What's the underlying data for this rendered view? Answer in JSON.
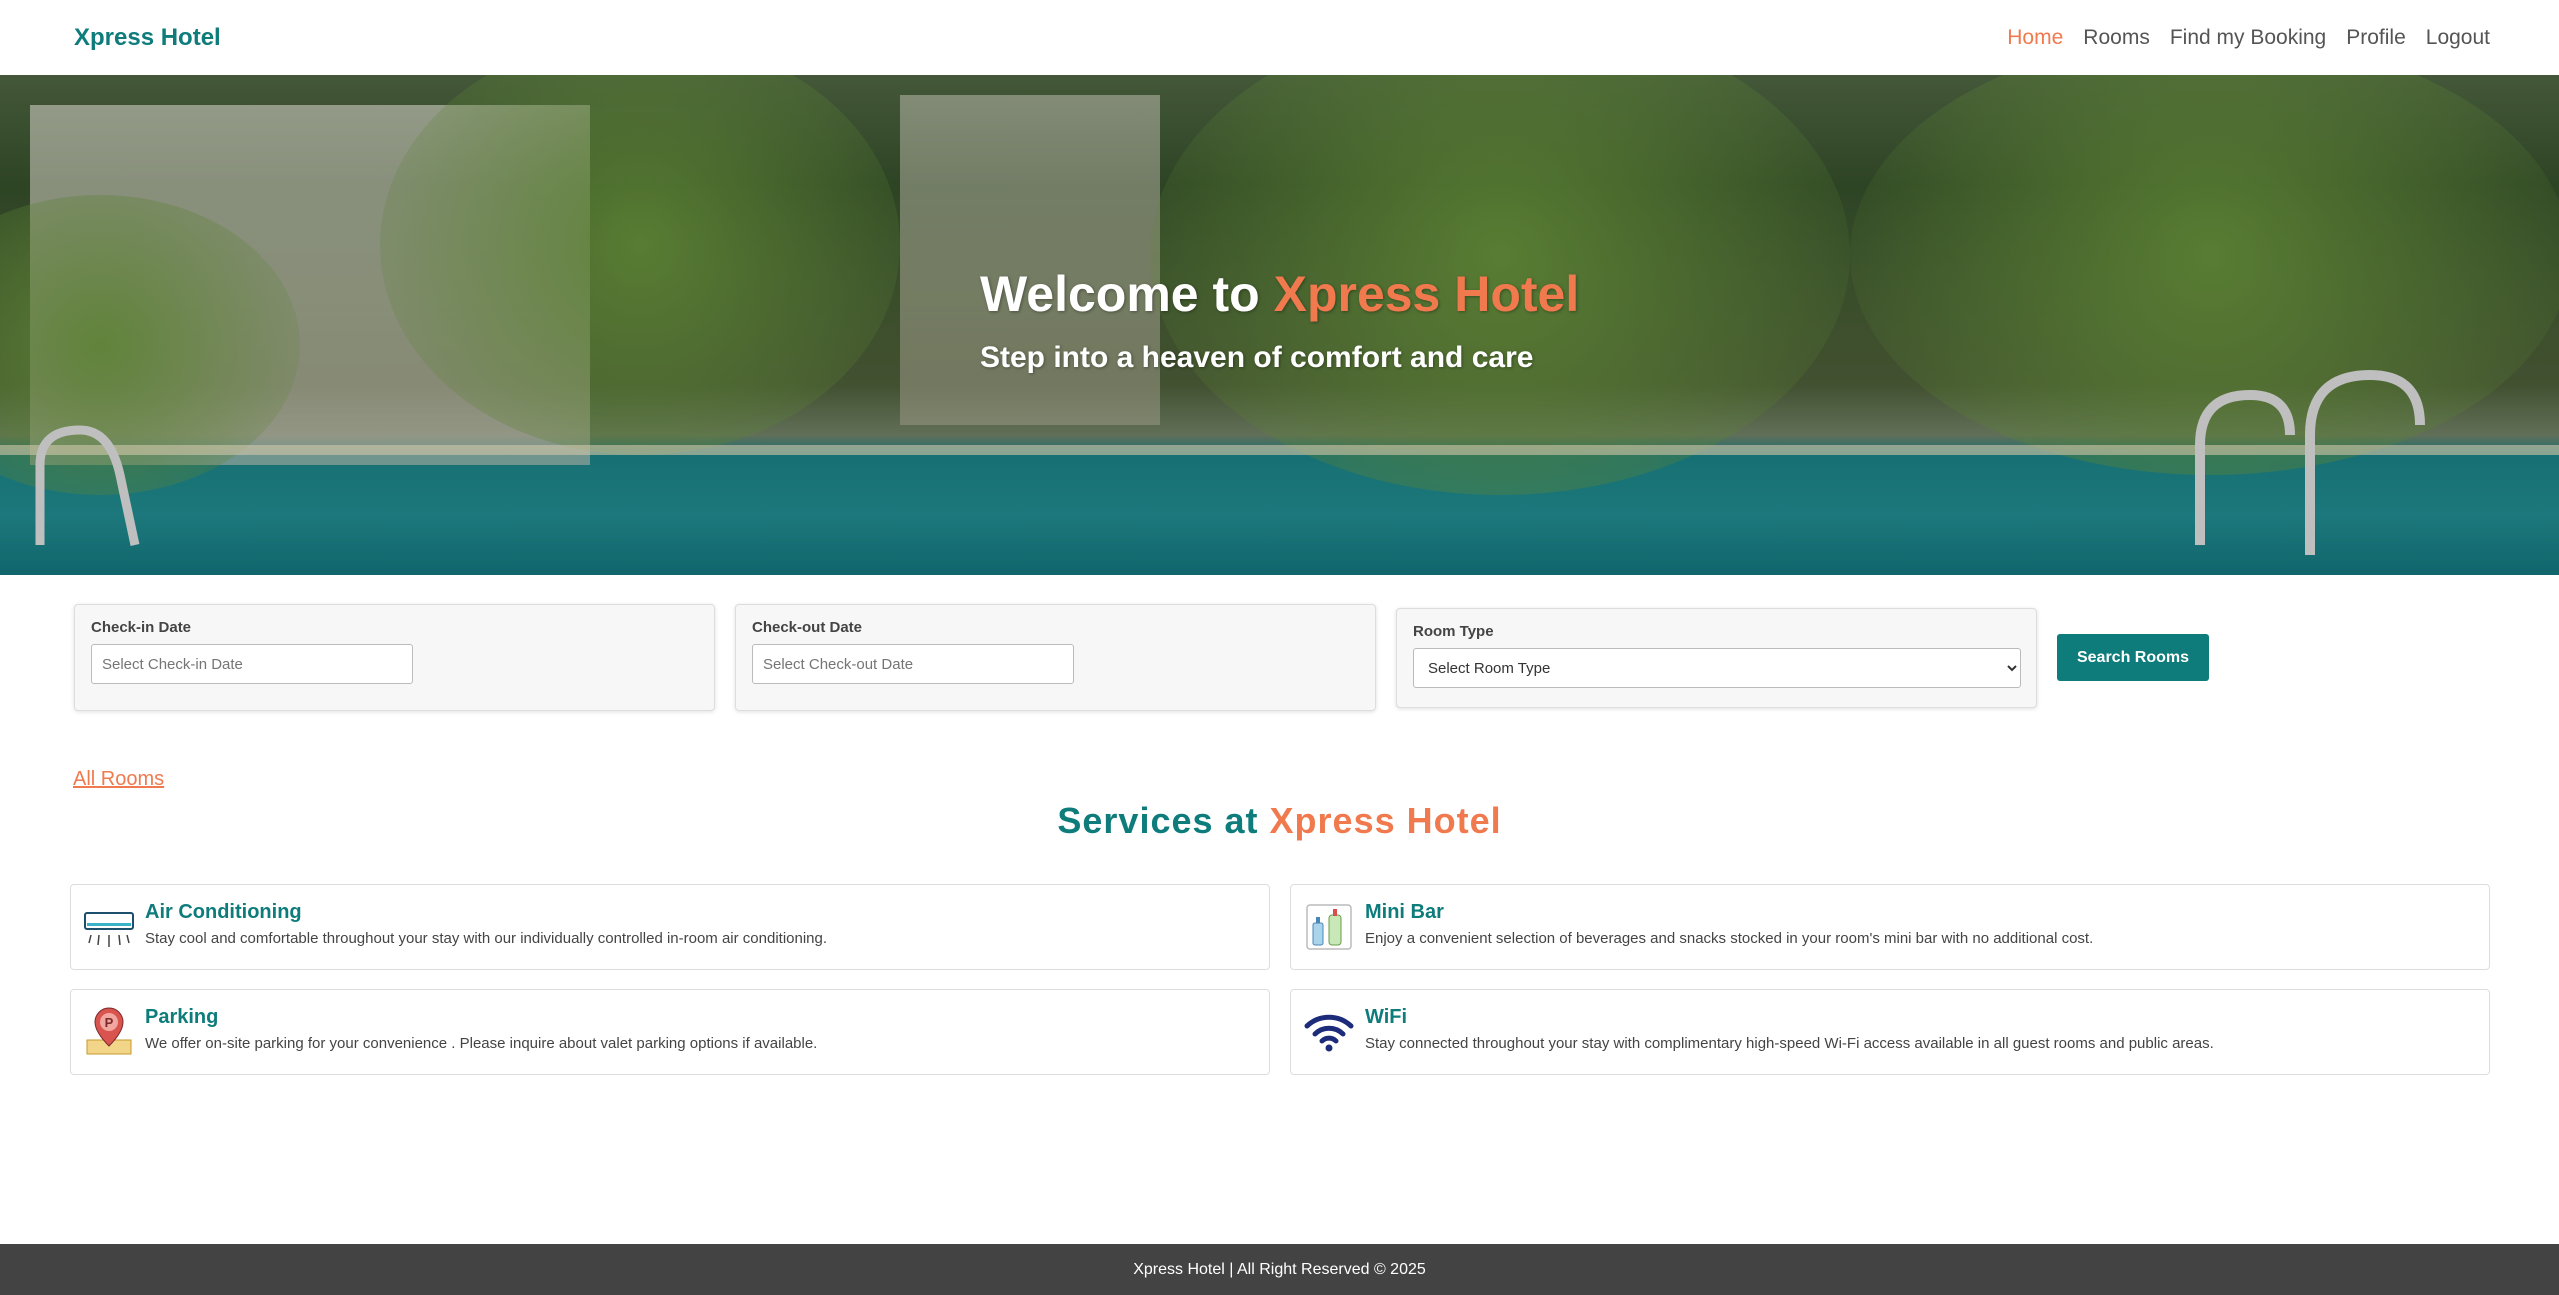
{
  "brand": "Xpress Hotel",
  "nav": [
    {
      "label": "Home",
      "active": true
    },
    {
      "label": "Rooms"
    },
    {
      "label": "Find my Booking"
    },
    {
      "label": "Profile"
    },
    {
      "label": "Logout"
    }
  ],
  "hero": {
    "title_prefix": "Welcome to",
    "title_accent": "Xpress Hotel",
    "subtitle": "Step into a heaven of comfort and care"
  },
  "search": {
    "checkin_label": "Check-in Date",
    "checkin_placeholder": "Select Check-in Date",
    "checkout_label": "Check-out Date",
    "checkout_placeholder": "Select Check-out Date",
    "roomtype_label": "Room Type",
    "roomtype_selected": "Select Room Type",
    "button": "Search Rooms"
  },
  "all_rooms_link": "All Rooms",
  "services": {
    "title_prefix": "Services at",
    "title_accent": "Xpress Hotel",
    "items": [
      {
        "name": "Air Conditioning",
        "desc": "Stay cool and comfortable throughout your stay with our individually controlled in-room air conditioning.",
        "icon": "air-conditioner-icon"
      },
      {
        "name": "Mini Bar",
        "desc": "Enjoy a convenient selection of beverages and snacks stocked in your room's mini bar with no additional cost.",
        "icon": "mini-bar-icon"
      },
      {
        "name": "Parking",
        "desc": "We offer on-site parking for your convenience . Please inquire about valet parking options if available.",
        "icon": "parking-icon"
      },
      {
        "name": "WiFi",
        "desc": "Stay connected throughout your stay with complimentary high-speed Wi-Fi access available in all guest rooms and public areas.",
        "icon": "wifi-icon"
      }
    ]
  },
  "footer": "Xpress Hotel | All Right Reserved © 2025",
  "colors": {
    "brand_teal": "#0e7c7b",
    "accent_orange": "#f07a4e",
    "footer_bg": "#434343"
  }
}
